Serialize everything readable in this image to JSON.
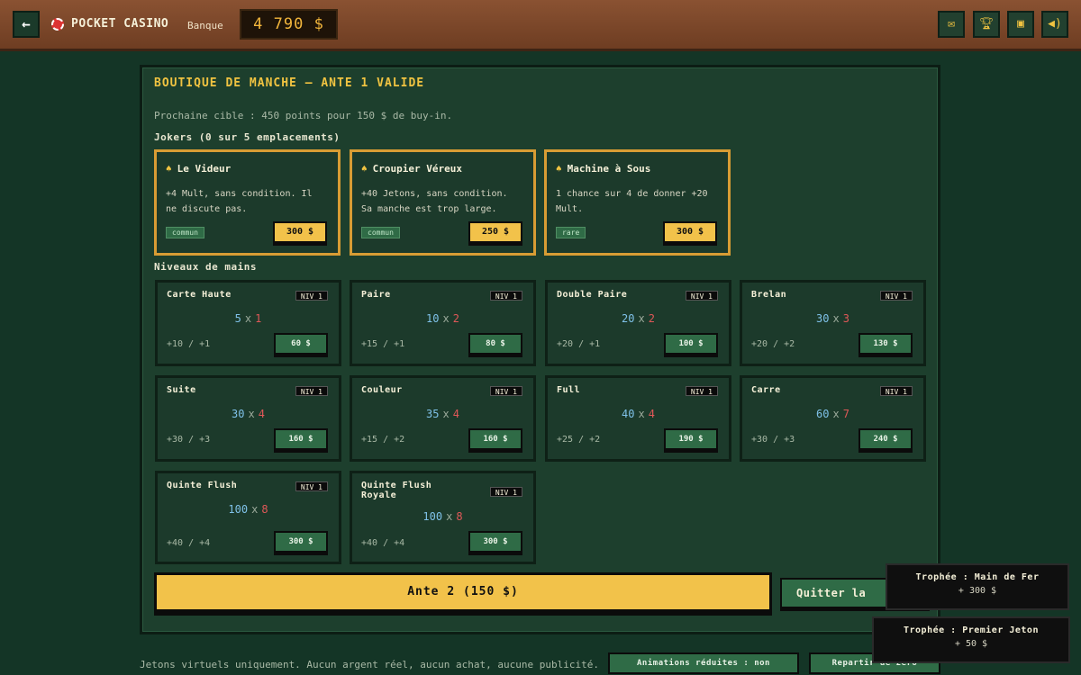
{
  "header": {
    "back_icon": "←",
    "title": "POCKET CASINO",
    "bank_label": "Banque",
    "bank_amount": "4 790 $",
    "icons": [
      "mail-icon",
      "trophy-icon",
      "gift-icon",
      "sound-icon"
    ]
  },
  "shop": {
    "title": "BOUTIQUE DE MANCHE — ANTE 1 VALIDE",
    "subtitle": "Prochaine cible : 450 points pour 150 $ de buy-in.",
    "jokers_label": "Jokers (0 sur 5 emplacements)",
    "hands_label": "Niveaux de mains",
    "jokers": [
      {
        "name": "Le Videur",
        "desc": "+4 Mult, sans condition. Il ne discute pas.",
        "rarity": "commun",
        "price": "300 $"
      },
      {
        "name": "Croupier Véreux",
        "desc": "+40 Jetons, sans condition. Sa manche est trop large.",
        "rarity": "commun",
        "price": "250 $"
      },
      {
        "name": "Machine à Sous",
        "desc": "1 chance sur 4 de donner +20 Mult.",
        "rarity": "rare",
        "price": "300 $"
      }
    ],
    "hands": [
      {
        "name": "Carte Haute",
        "level": "NIV 1",
        "chips": "5",
        "mult": "1",
        "gain": "+10 / +1",
        "price": "60 $"
      },
      {
        "name": "Paire",
        "level": "NIV 1",
        "chips": "10",
        "mult": "2",
        "gain": "+15 / +1",
        "price": "80 $"
      },
      {
        "name": "Double Paire",
        "level": "NIV 1",
        "chips": "20",
        "mult": "2",
        "gain": "+20 / +1",
        "price": "100 $"
      },
      {
        "name": "Brelan",
        "level": "NIV 1",
        "chips": "30",
        "mult": "3",
        "gain": "+20 / +2",
        "price": "130 $"
      },
      {
        "name": "Suite",
        "level": "NIV 1",
        "chips": "30",
        "mult": "4",
        "gain": "+30 / +3",
        "price": "160 $"
      },
      {
        "name": "Couleur",
        "level": "NIV 1",
        "chips": "35",
        "mult": "4",
        "gain": "+15 / +2",
        "price": "160 $"
      },
      {
        "name": "Full",
        "level": "NIV 1",
        "chips": "40",
        "mult": "4",
        "gain": "+25 / +2",
        "price": "190 $"
      },
      {
        "name": "Carre",
        "level": "NIV 1",
        "chips": "60",
        "mult": "7",
        "gain": "+30 / +3",
        "price": "240 $"
      },
      {
        "name": "Quinte Flush",
        "level": "NIV 1",
        "chips": "100",
        "mult": "8",
        "gain": "+40 / +4",
        "price": "300 $"
      },
      {
        "name": "Quinte Flush Royale",
        "level": "NIV 1",
        "chips": "100",
        "mult": "8",
        "gain": "+40 / +4",
        "price": "300 $"
      }
    ],
    "x_symbol": "x",
    "spade": "♠",
    "ante_button": "Ante 2 (150 $)",
    "quit_button": "Quitter la"
  },
  "footer": {
    "disclaimer": "Jetons virtuels uniquement. Aucun argent réel, aucun achat, aucune publicité.",
    "animations_button": "Animations réduites : non",
    "reset_button": "Repartir de zéro"
  },
  "toasts": [
    {
      "title": "Trophée : Main de Fer",
      "reward": "+ 300 $"
    },
    {
      "title": "Trophée : Premier Jeton",
      "reward": "+ 50 $"
    }
  ]
}
